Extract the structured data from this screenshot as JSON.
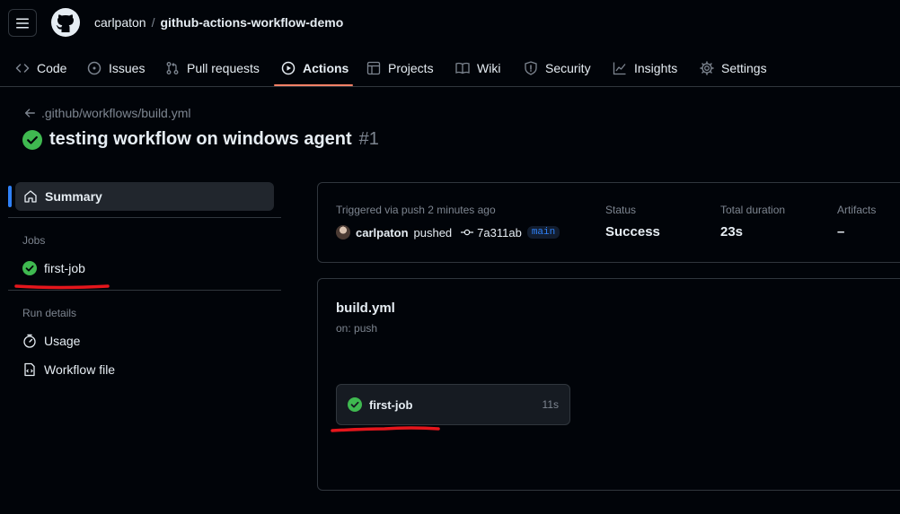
{
  "header": {
    "owner": "carlpaton",
    "separator": "/",
    "repo": "github-actions-workflow-demo"
  },
  "nav": [
    {
      "label": "Code",
      "icon": "code-icon",
      "active": false
    },
    {
      "label": "Issues",
      "icon": "issue-icon",
      "active": false
    },
    {
      "label": "Pull requests",
      "icon": "pull-request-icon",
      "active": false
    },
    {
      "label": "Actions",
      "icon": "play-icon",
      "active": true
    },
    {
      "label": "Projects",
      "icon": "table-icon",
      "active": false
    },
    {
      "label": "Wiki",
      "icon": "book-icon",
      "active": false
    },
    {
      "label": "Security",
      "icon": "shield-icon",
      "active": false
    },
    {
      "label": "Insights",
      "icon": "graph-icon",
      "active": false
    },
    {
      "label": "Settings",
      "icon": "gear-icon",
      "active": false
    }
  ],
  "run": {
    "workflow_path": ".github/workflows/build.yml",
    "title": "testing workflow on windows agent",
    "number": "#1"
  },
  "sidebar": {
    "summary_label": "Summary",
    "jobs_heading": "Jobs",
    "job_label": "first-job",
    "run_details_heading": "Run details",
    "usage_label": "Usage",
    "workflow_file_label": "Workflow file"
  },
  "summary": {
    "triggered_text": "Triggered via push 2 minutes ago",
    "user": "carlpaton",
    "pushed_text": "pushed",
    "commit_sha": "7a311ab",
    "branch": "main",
    "status_label": "Status",
    "status_value": "Success",
    "duration_label": "Total duration",
    "duration_value": "23s",
    "artifacts_label": "Artifacts",
    "artifacts_value": "–"
  },
  "graph": {
    "workflow_file": "build.yml",
    "trigger": "on: push",
    "job_name": "first-job",
    "job_duration": "11s"
  },
  "colors": {
    "background": "#010409",
    "border": "#30363d",
    "success": "#3fb950",
    "accent": "#2f81f7",
    "active_tab": "#f78166",
    "annotation": "#e5161c"
  }
}
